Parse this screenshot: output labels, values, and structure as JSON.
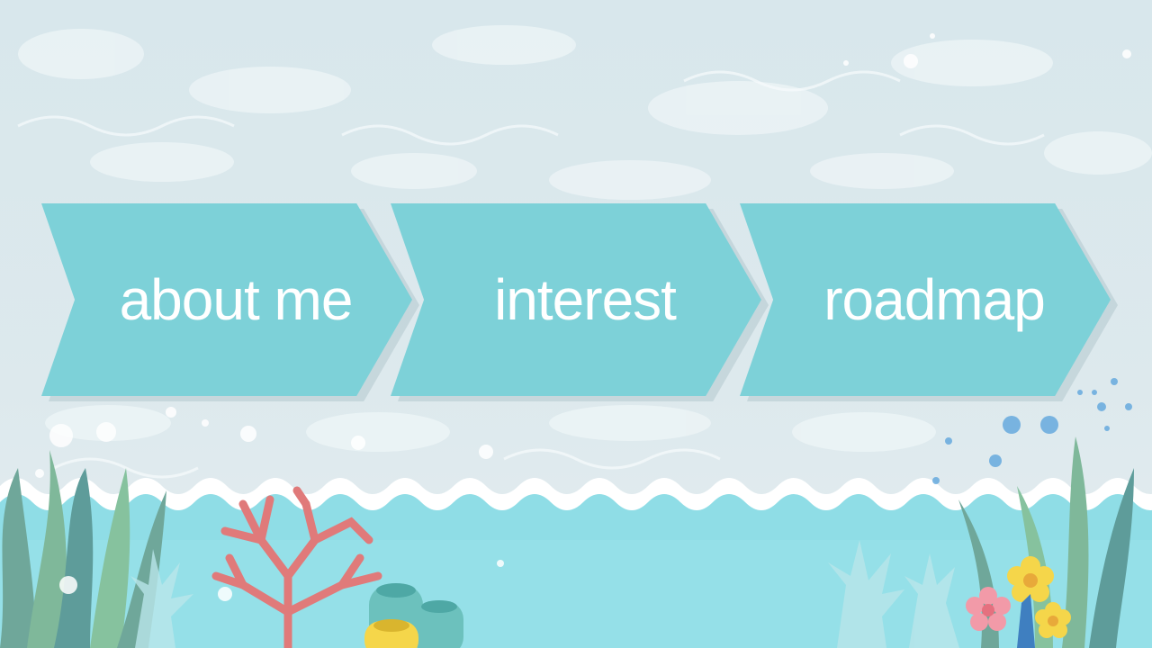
{
  "nav": {
    "items": [
      {
        "label": "about me"
      },
      {
        "label": "interest"
      },
      {
        "label": "roadmap"
      }
    ]
  },
  "colors": {
    "chevron": "#7dd1d8",
    "sea": "#8fdde6",
    "wave": "#ffffff",
    "coral_red": "#e07a7a",
    "seaweed_green": "#7fb89a",
    "flower_yellow": "#f5d64a",
    "flower_pink": "#f29aa8"
  },
  "icons": [
    "water-background",
    "wave-border",
    "seaweed-left",
    "coral-red",
    "sponge-yellow",
    "coral-right",
    "flower-yellow",
    "flower-pink",
    "bubbles"
  ]
}
